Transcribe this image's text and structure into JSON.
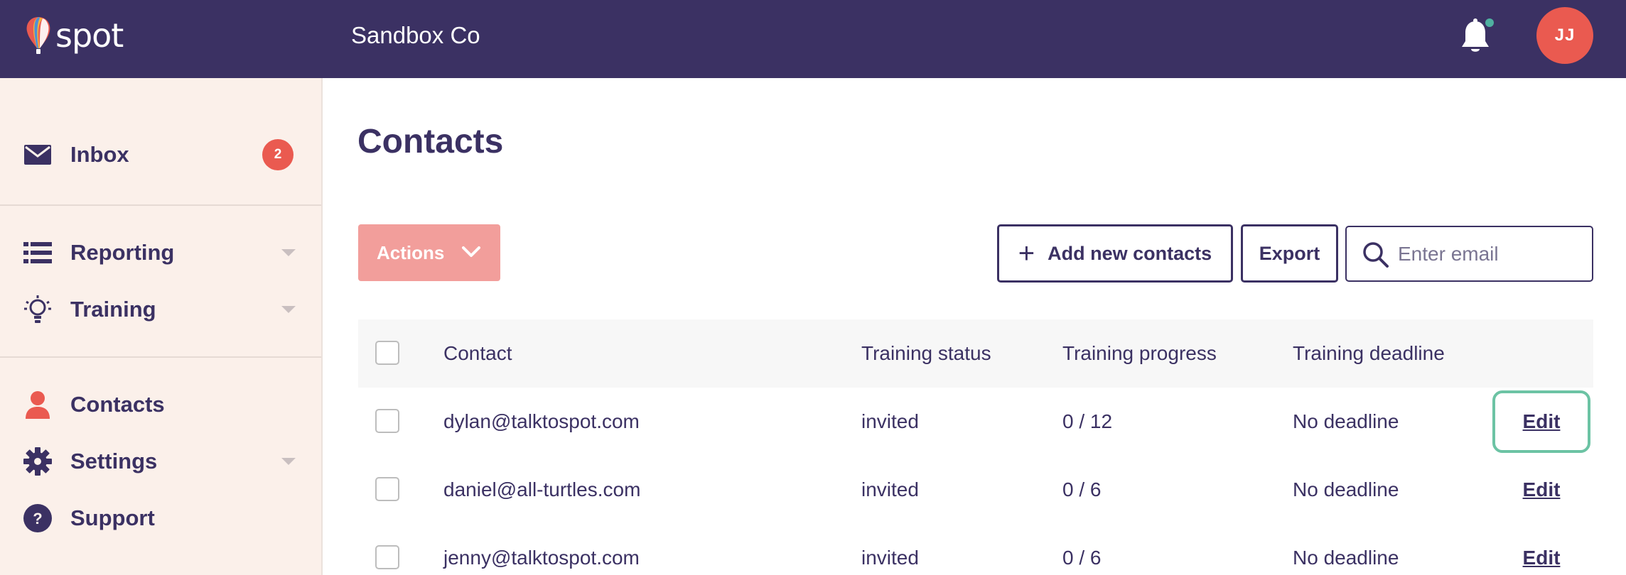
{
  "header": {
    "logo_text": "spot",
    "company": "Sandbox Co",
    "avatar_initials": "JJ"
  },
  "sidebar": {
    "items": [
      {
        "label": "Inbox",
        "badge": "2"
      },
      {
        "label": "Reporting"
      },
      {
        "label": "Training"
      },
      {
        "label": "Contacts"
      },
      {
        "label": "Settings"
      },
      {
        "label": "Support"
      }
    ]
  },
  "main": {
    "title": "Contacts",
    "actions_label": "Actions",
    "add_label": "Add new contacts",
    "export_label": "Export",
    "search_placeholder": "Enter email"
  },
  "table": {
    "columns": {
      "contact": "Contact",
      "status": "Training status",
      "progress": "Training progress",
      "deadline": "Training deadline"
    },
    "rows": [
      {
        "email": "dylan@talktospot.com",
        "status": "invited",
        "progress": "0 / 12",
        "deadline": "No deadline",
        "edit": "Edit"
      },
      {
        "email": "daniel@all-turtles.com",
        "status": "invited",
        "progress": "0 / 6",
        "deadline": "No deadline",
        "edit": "Edit"
      },
      {
        "email": "jenny@talktospot.com",
        "status": "invited",
        "progress": "0 / 6",
        "deadline": "No deadline",
        "edit": "Edit"
      }
    ]
  },
  "colors": {
    "brand": "#3b3163",
    "accent": "#ea5a50",
    "sidebar_bg": "#fbf0ea",
    "focus": "#6cc3a4"
  }
}
